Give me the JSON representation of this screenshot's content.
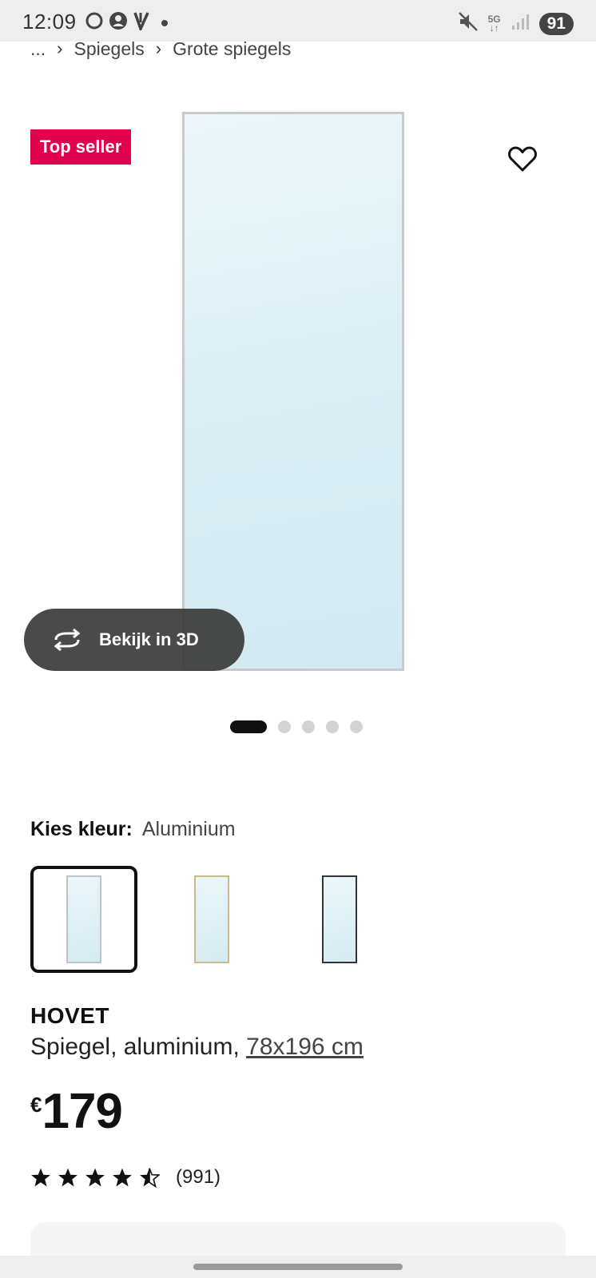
{
  "status_bar": {
    "time": "12:09",
    "battery": "91",
    "network": "5G"
  },
  "breadcrumb": {
    "ellipsis": "...",
    "items": [
      "Spiegels",
      "Grote spiegels"
    ]
  },
  "product_image": {
    "badge": "Top seller",
    "view_3d_label": "Bekijk in 3D",
    "image_count": 5,
    "active_image_index": 0
  },
  "color_selector": {
    "label": "Kies kleur:",
    "selected_value": "Aluminium",
    "options": [
      "aluminium",
      "gold",
      "black"
    ]
  },
  "product": {
    "name": "HOVET",
    "description": "Spiegel, aluminium, ",
    "size": "78x196 cm",
    "currency": "€",
    "price": "179",
    "rating_value": 4.5,
    "rating_count": "(991)"
  },
  "colors": {
    "badge_bg": "#e0004d",
    "text": "#111111"
  }
}
